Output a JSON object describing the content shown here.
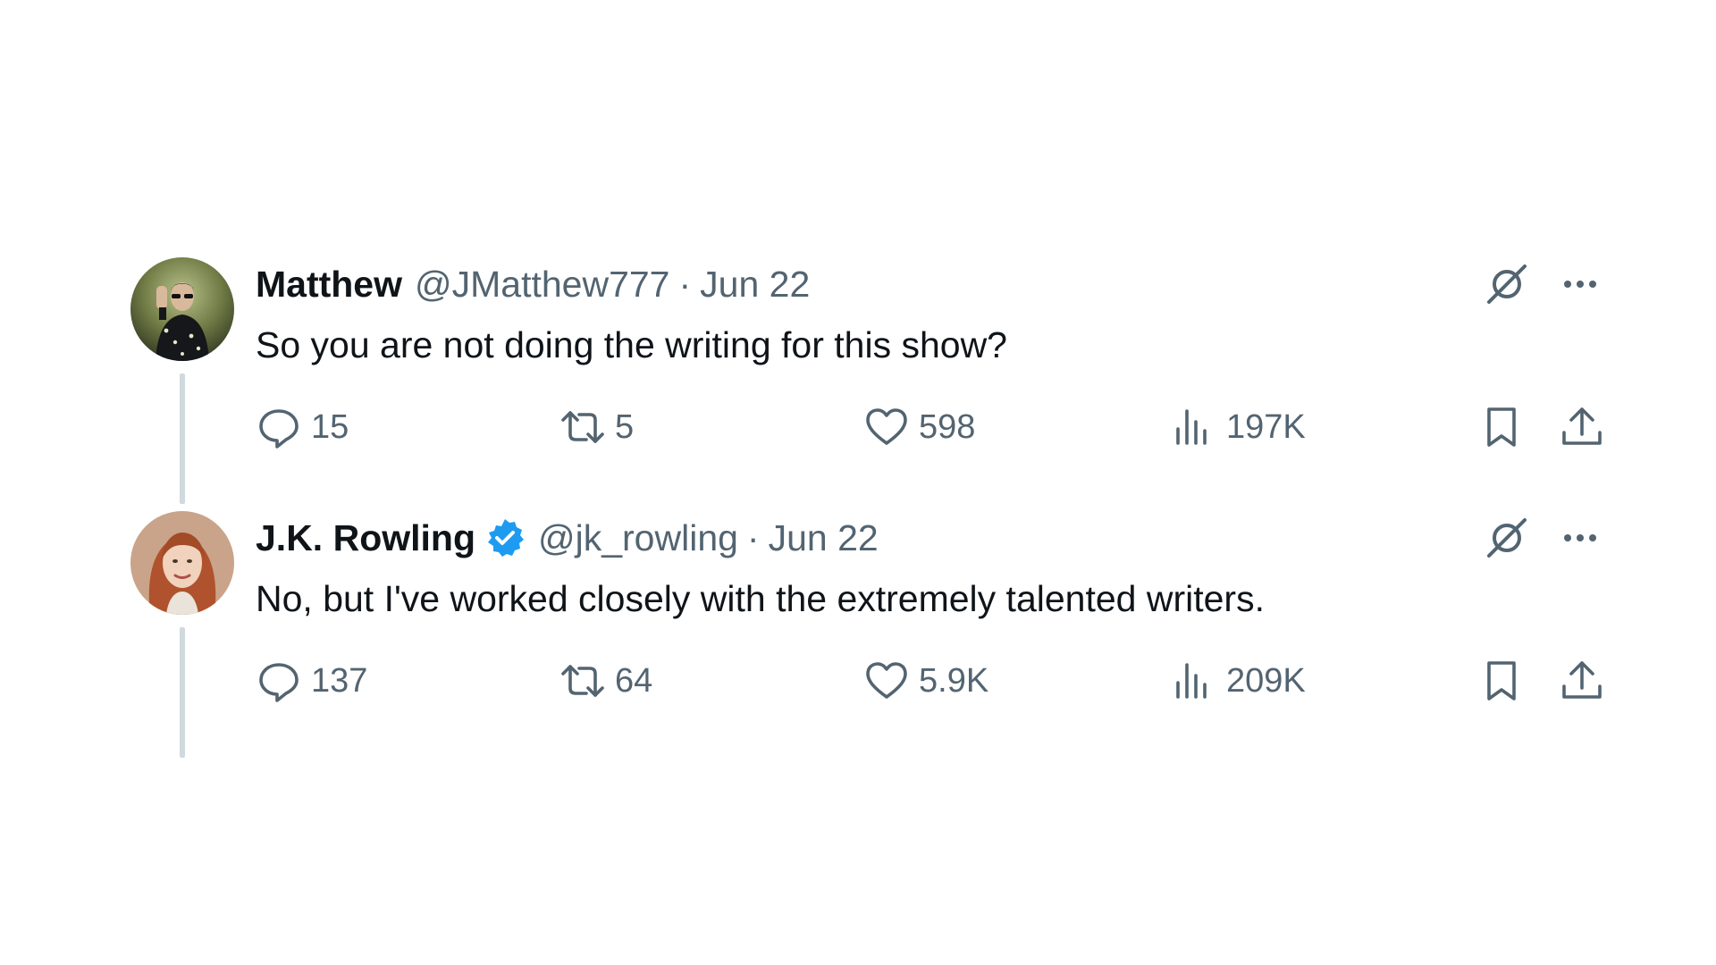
{
  "tweets": [
    {
      "name": "Matthew",
      "handle": "@JMatthew777",
      "separator": "·",
      "date": "Jun 22",
      "verified": false,
      "text": "So you are not doing the writing for this show?",
      "stats": {
        "replies": "15",
        "retweets": "5",
        "likes": "598",
        "views": "197K"
      },
      "avatar_icon": "user-avatar-matthew"
    },
    {
      "name": "J.K. Rowling",
      "handle": "@jk_rowling",
      "separator": "·",
      "date": "Jun 22",
      "verified": true,
      "text": "No, but I've worked closely with the extremely talented writers.",
      "stats": {
        "replies": "137",
        "retweets": "64",
        "likes": "5.9K",
        "views": "209K"
      },
      "avatar_icon": "user-avatar-jk-rowling"
    }
  ],
  "colors": {
    "text_primary": "#0f1419",
    "text_secondary": "#536471",
    "verified_blue": "#1d9bf0",
    "thread_line": "#cfd9de"
  },
  "icons": {
    "header": [
      "grok-icon",
      "more-icon"
    ],
    "actions": [
      "reply-icon",
      "retweet-icon",
      "like-icon",
      "views-icon",
      "bookmark-icon",
      "share-icon"
    ]
  }
}
